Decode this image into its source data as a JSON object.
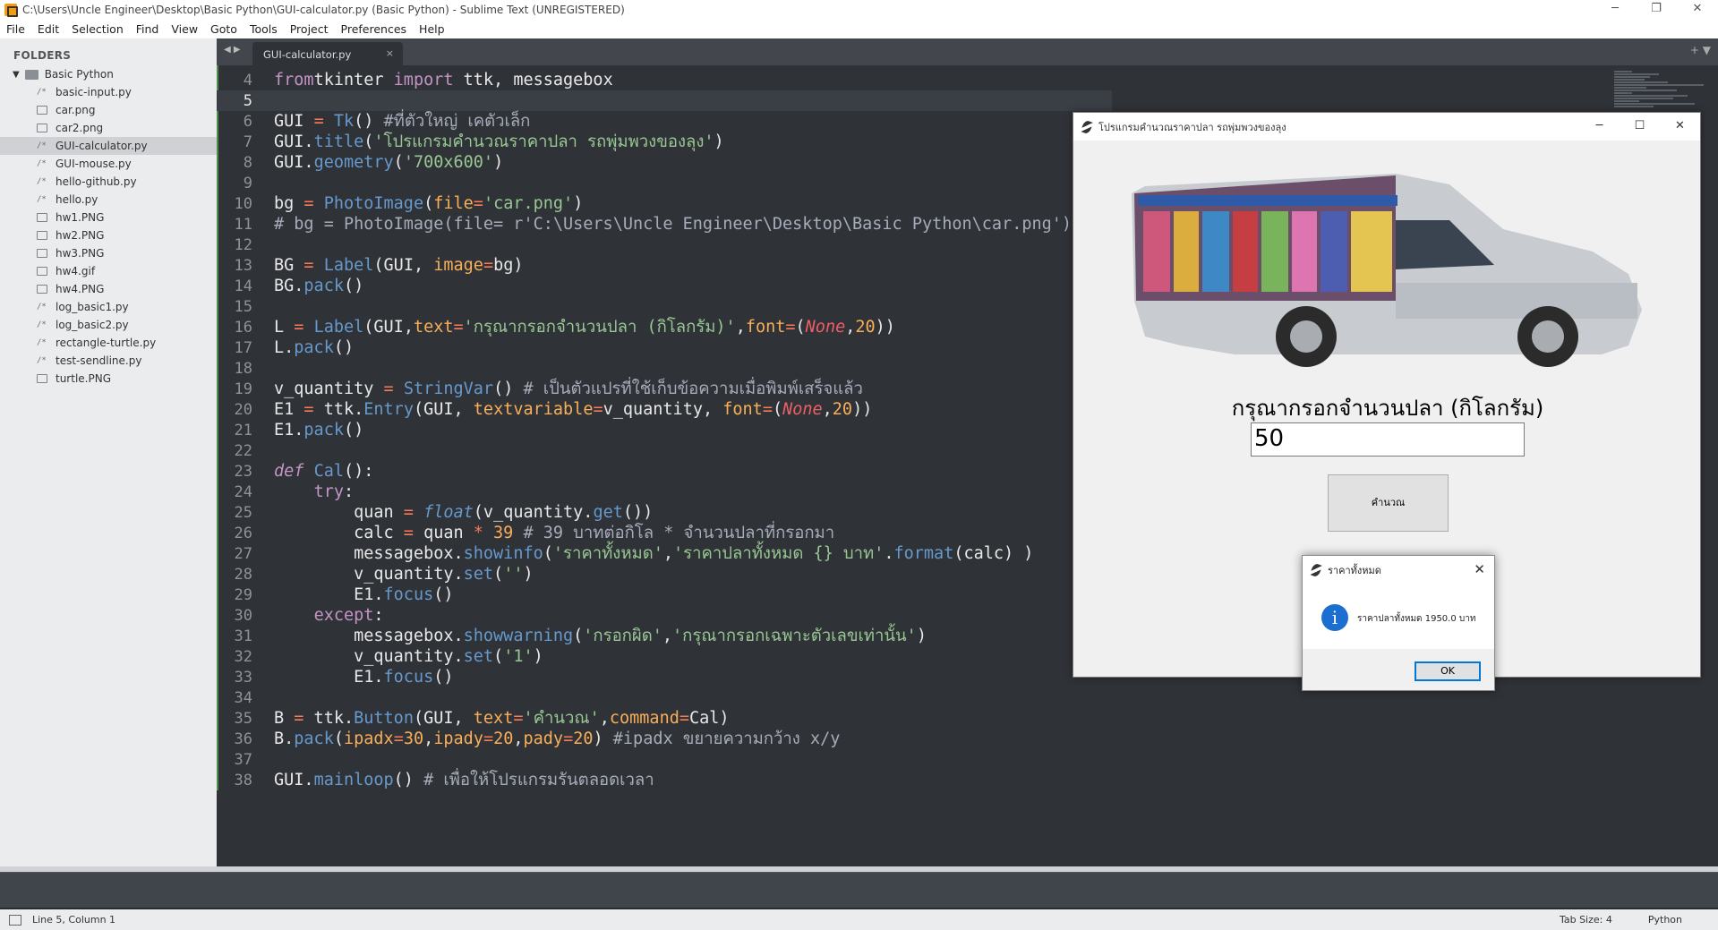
{
  "window": {
    "title": "C:\\Users\\Uncle Engineer\\Desktop\\Basic Python\\GUI-calculator.py (Basic Python) - Sublime Text (UNREGISTERED)",
    "controls": [
      "─",
      "❐",
      "✕"
    ]
  },
  "menu": [
    "File",
    "Edit",
    "Selection",
    "Find",
    "View",
    "Goto",
    "Tools",
    "Project",
    "Preferences",
    "Help"
  ],
  "sidebar": {
    "header": "FOLDERS",
    "root": "Basic Python",
    "files": [
      {
        "name": "basic-input.py",
        "type": "code"
      },
      {
        "name": "car.png",
        "type": "image"
      },
      {
        "name": "car2.png",
        "type": "image"
      },
      {
        "name": "GUI-calculator.py",
        "type": "code",
        "active": true
      },
      {
        "name": "GUI-mouse.py",
        "type": "code"
      },
      {
        "name": "hello-github.py",
        "type": "code"
      },
      {
        "name": "hello.py",
        "type": "code"
      },
      {
        "name": "hw1.PNG",
        "type": "image"
      },
      {
        "name": "hw2.PNG",
        "type": "image"
      },
      {
        "name": "hw3.PNG",
        "type": "image"
      },
      {
        "name": "hw4.gif",
        "type": "image"
      },
      {
        "name": "hw4.PNG",
        "type": "image"
      },
      {
        "name": "log_basic1.py",
        "type": "code"
      },
      {
        "name": "log_basic2.py",
        "type": "code"
      },
      {
        "name": "rectangle-turtle.py",
        "type": "code"
      },
      {
        "name": "test-sendline.py",
        "type": "code"
      },
      {
        "name": "turtle.PNG",
        "type": "image"
      }
    ]
  },
  "tab": {
    "label": "GUI-calculator.py",
    "close": "×",
    "arrows": "◀ ▶",
    "right": "+ ▼"
  },
  "editor": {
    "current_line": 5,
    "lines": [
      {
        "n": 4,
        "tokens": [
          [
            "kw",
            "from"
          ],
          [
            "",
            "tkinter "
          ],
          [
            "kw",
            "import"
          ],
          [
            "",
            " ttk, messagebox"
          ]
        ]
      },
      {
        "n": 5,
        "tokens": []
      },
      {
        "n": 6,
        "tokens": [
          [
            "",
            "GUI "
          ],
          [
            "op",
            "="
          ],
          [
            "",
            " "
          ],
          [
            "fn",
            "Tk"
          ],
          [
            "",
            "() "
          ],
          [
            "com",
            "#ที่ตัวใหญ่ เคตัวเล็ก"
          ]
        ]
      },
      {
        "n": 7,
        "tokens": [
          [
            "",
            "GUI."
          ],
          [
            "fn",
            "title"
          ],
          [
            "",
            "("
          ],
          [
            "str",
            "'โปรแกรมคำนวณราคาปลา รถพุ่มพวงของลุง'"
          ],
          [
            "",
            ")"
          ]
        ]
      },
      {
        "n": 8,
        "tokens": [
          [
            "",
            "GUI."
          ],
          [
            "fn",
            "geometry"
          ],
          [
            "",
            "("
          ],
          [
            "str",
            "'700x600'"
          ],
          [
            "",
            ")"
          ]
        ]
      },
      {
        "n": 9,
        "tokens": []
      },
      {
        "n": 10,
        "tokens": [
          [
            "",
            "bg "
          ],
          [
            "op",
            "="
          ],
          [
            "",
            " "
          ],
          [
            "fn",
            "PhotoImage"
          ],
          [
            "",
            "("
          ],
          [
            "arg",
            "file"
          ],
          [
            "op",
            "="
          ],
          [
            "str",
            "'car.png'"
          ],
          [
            "",
            ")"
          ]
        ]
      },
      {
        "n": 11,
        "tokens": [
          [
            "com",
            "# bg = PhotoImage(file= r'C:\\Users\\Uncle Engineer\\Desktop\\Basic Python\\car.png')"
          ]
        ]
      },
      {
        "n": 12,
        "tokens": []
      },
      {
        "n": 13,
        "tokens": [
          [
            "",
            "BG "
          ],
          [
            "op",
            "="
          ],
          [
            "",
            " "
          ],
          [
            "fn",
            "Label"
          ],
          [
            "",
            "(GUI, "
          ],
          [
            "arg",
            "image"
          ],
          [
            "op",
            "="
          ],
          [
            "",
            "bg)"
          ]
        ]
      },
      {
        "n": 14,
        "tokens": [
          [
            "",
            "BG."
          ],
          [
            "fn",
            "pack"
          ],
          [
            "",
            "()"
          ]
        ]
      },
      {
        "n": 15,
        "tokens": []
      },
      {
        "n": 16,
        "tokens": [
          [
            "",
            "L "
          ],
          [
            "op",
            "="
          ],
          [
            "",
            " "
          ],
          [
            "fn",
            "Label"
          ],
          [
            "",
            "(GUI,"
          ],
          [
            "arg",
            "text"
          ],
          [
            "op",
            "="
          ],
          [
            "str",
            "'กรุณากรอกจำนวนปลา (กิโลกรัม)'"
          ],
          [
            "",
            ","
          ],
          [
            "arg",
            "font"
          ],
          [
            "op",
            "="
          ],
          [
            "",
            "("
          ],
          [
            "none",
            "None"
          ],
          [
            "",
            ","
          ],
          [
            "num",
            "20"
          ],
          [
            "",
            "))"
          ]
        ]
      },
      {
        "n": 17,
        "tokens": [
          [
            "",
            "L."
          ],
          [
            "fn",
            "pack"
          ],
          [
            "",
            "()"
          ]
        ]
      },
      {
        "n": 18,
        "tokens": []
      },
      {
        "n": 19,
        "tokens": [
          [
            "",
            "v_quantity "
          ],
          [
            "op",
            "="
          ],
          [
            "",
            " "
          ],
          [
            "fn",
            "StringVar"
          ],
          [
            "",
            "() "
          ],
          [
            "com",
            "# เป็นตัวแปรที่ใช้เก็บข้อความเมื่อพิมพ์เสร็จแล้ว"
          ]
        ]
      },
      {
        "n": 20,
        "tokens": [
          [
            "",
            "E1 "
          ],
          [
            "op",
            "="
          ],
          [
            "",
            " ttk."
          ],
          [
            "fn",
            "Entry"
          ],
          [
            "",
            "(GUI, "
          ],
          [
            "arg",
            "textvariable"
          ],
          [
            "op",
            "="
          ],
          [
            "",
            "v_quantity, "
          ],
          [
            "arg",
            "font"
          ],
          [
            "op",
            "="
          ],
          [
            "",
            "("
          ],
          [
            "none",
            "None"
          ],
          [
            "",
            ","
          ],
          [
            "num",
            "20"
          ],
          [
            "",
            "))"
          ]
        ]
      },
      {
        "n": 21,
        "tokens": [
          [
            "",
            "E1."
          ],
          [
            "fn",
            "pack"
          ],
          [
            "",
            "()"
          ]
        ]
      },
      {
        "n": 22,
        "tokens": []
      },
      {
        "n": 23,
        "tokens": [
          [
            "kwit",
            "def"
          ],
          [
            "",
            " "
          ],
          [
            "fn",
            "Cal"
          ],
          [
            "",
            "():"
          ]
        ]
      },
      {
        "n": 24,
        "tokens": [
          [
            "",
            "    "
          ],
          [
            "kw",
            "try"
          ],
          [
            "",
            ":"
          ]
        ]
      },
      {
        "n": 25,
        "tokens": [
          [
            "",
            "        quan "
          ],
          [
            "op",
            "="
          ],
          [
            "",
            " "
          ],
          [
            "fnit",
            "float"
          ],
          [
            "",
            "(v_quantity."
          ],
          [
            "fn",
            "get"
          ],
          [
            "",
            "())"
          ]
        ]
      },
      {
        "n": 26,
        "tokens": [
          [
            "",
            "        calc "
          ],
          [
            "op",
            "="
          ],
          [
            "",
            " quan "
          ],
          [
            "op",
            "*"
          ],
          [
            "",
            " "
          ],
          [
            "num",
            "39"
          ],
          [
            "",
            " "
          ],
          [
            "com",
            "# 39 บาทต่อกิโล * จำนวนปลาที่กรอกมา"
          ]
        ]
      },
      {
        "n": 27,
        "tokens": [
          [
            "",
            "        messagebox."
          ],
          [
            "fn",
            "showinfo"
          ],
          [
            "",
            "("
          ],
          [
            "str",
            "'ราคาทั้งหมด'"
          ],
          [
            "",
            ","
          ],
          [
            "str",
            "'ราคาปลาทั้งหมด {} บาท'"
          ],
          [
            "",
            "."
          ],
          [
            "fn",
            "format"
          ],
          [
            "",
            "(calc) )"
          ]
        ]
      },
      {
        "n": 28,
        "tokens": [
          [
            "",
            "        v_quantity."
          ],
          [
            "fn",
            "set"
          ],
          [
            "",
            "("
          ],
          [
            "str",
            "''"
          ],
          [
            "",
            ")"
          ]
        ]
      },
      {
        "n": 29,
        "tokens": [
          [
            "",
            "        E1."
          ],
          [
            "fn",
            "focus"
          ],
          [
            "",
            "()"
          ]
        ]
      },
      {
        "n": 30,
        "tokens": [
          [
            "",
            "    "
          ],
          [
            "kw",
            "except"
          ],
          [
            "",
            ":"
          ]
        ]
      },
      {
        "n": 31,
        "tokens": [
          [
            "",
            "        messagebox."
          ],
          [
            "fn",
            "showwarning"
          ],
          [
            "",
            "("
          ],
          [
            "str",
            "'กรอกผิด'"
          ],
          [
            "",
            ","
          ],
          [
            "str",
            "'กรุณากรอกเฉพาะตัวเลขเท่านั้น'"
          ],
          [
            "",
            ")"
          ]
        ]
      },
      {
        "n": 32,
        "tokens": [
          [
            "",
            "        v_quantity."
          ],
          [
            "fn",
            "set"
          ],
          [
            "",
            "("
          ],
          [
            "str",
            "'1'"
          ],
          [
            "",
            ")"
          ]
        ]
      },
      {
        "n": 33,
        "tokens": [
          [
            "",
            "        E1."
          ],
          [
            "fn",
            "focus"
          ],
          [
            "",
            "()"
          ]
        ]
      },
      {
        "n": 34,
        "tokens": []
      },
      {
        "n": 35,
        "tokens": [
          [
            "",
            "B "
          ],
          [
            "op",
            "="
          ],
          [
            "",
            " ttk."
          ],
          [
            "fn",
            "Button"
          ],
          [
            "",
            "(GUI, "
          ],
          [
            "arg",
            "text"
          ],
          [
            "op",
            "="
          ],
          [
            "str",
            "'คำนวณ'"
          ],
          [
            "",
            ","
          ],
          [
            "arg",
            "command"
          ],
          [
            "op",
            "="
          ],
          [
            "",
            "Cal)"
          ]
        ]
      },
      {
        "n": 36,
        "tokens": [
          [
            "",
            "B."
          ],
          [
            "fn",
            "pack"
          ],
          [
            "",
            "("
          ],
          [
            "arg",
            "ipadx"
          ],
          [
            "op",
            "="
          ],
          [
            "num",
            "30"
          ],
          [
            "",
            ","
          ],
          [
            "arg",
            "ipady"
          ],
          [
            "op",
            "="
          ],
          [
            "num",
            "20"
          ],
          [
            "",
            ","
          ],
          [
            "arg",
            "pady"
          ],
          [
            "op",
            "="
          ],
          [
            "num",
            "20"
          ],
          [
            "",
            ") "
          ],
          [
            "com",
            "#ipadx ขยายความกว้าง x/y"
          ]
        ]
      },
      {
        "n": 37,
        "tokens": []
      },
      {
        "n": 38,
        "tokens": [
          [
            "",
            "GUI."
          ],
          [
            "fn",
            "mainloop"
          ],
          [
            "",
            "() "
          ],
          [
            "com",
            "# เพื่อให้โปรแกรมรันตลอดเวลา"
          ]
        ]
      }
    ]
  },
  "status": {
    "position": "Line 5, Column 1",
    "tab_size": "Tab Size: 4",
    "syntax": "Python"
  },
  "tk_window": {
    "title": "โปรแกรมคำนวณราคาปลา รถพุ่มพวงของลุง",
    "controls": [
      "─",
      "☐",
      "✕"
    ],
    "label": "กรุณากรอกจำนวนปลา (กิโลกรัม)",
    "entry_value": "50",
    "button": "คำนวณ"
  },
  "messagebox": {
    "title": "ราคาทั้งหมด",
    "close": "✕",
    "icon": "i",
    "text": "ราคาปลาทั้งหมด 1950.0 บาท",
    "ok": "OK"
  }
}
